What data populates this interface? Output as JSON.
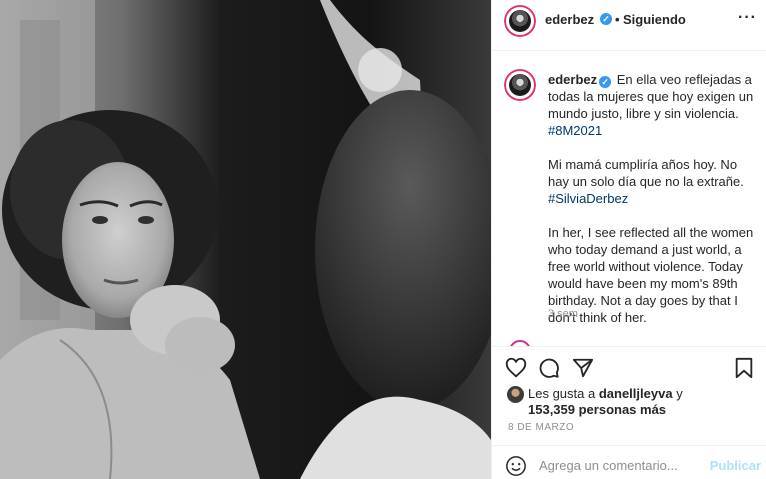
{
  "post": {
    "username": "ederbez",
    "verified": true,
    "follow_status": "Siguiendo",
    "more_icon": "more-options-icon"
  },
  "caption": {
    "username": "ederbez",
    "paragraph_1": "En ella veo reflejadas a todas la mujeres que hoy exigen un mundo justo, libre y sin violencia.",
    "hashtag_1": "#8M2021",
    "paragraph_2": "Mi mamá cumpliría años hoy. No hay un solo día que no la extrañe.",
    "hashtag_2": "#SilviaDerbez",
    "paragraph_3": "In her, I see reflected all the women who today demand a just world, a free world without violence. Today would have been my mom's 89th birthday. Not a day goes by that I don't think of her.",
    "time_ago": "3 sem"
  },
  "likes": {
    "prefix": "Les gusta a",
    "first_liker": "danelljleyva",
    "connector": "y",
    "count_text": "153,359 personas más"
  },
  "date": "8 DE MARZO",
  "comment": {
    "placeholder": "Agrega un comentario...",
    "publish_label": "Publicar"
  },
  "colors": {
    "verified_blue": "#3897f0",
    "hashtag": "#00376b",
    "publish_disabled": "#b2dffc",
    "story_ring": "#e1306c"
  }
}
